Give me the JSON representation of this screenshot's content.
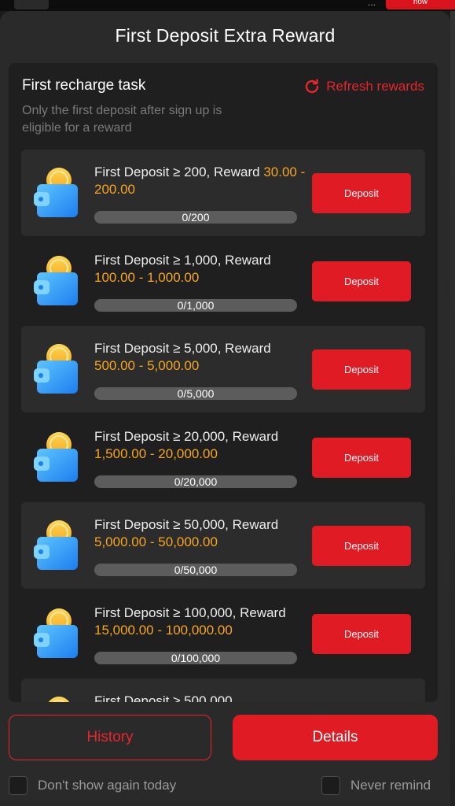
{
  "background": {
    "top_button_label": "now",
    "dots": "..."
  },
  "modal": {
    "title": "First Deposit Extra Reward"
  },
  "panel": {
    "heading": "First recharge task",
    "refresh_label": "Refresh rewards",
    "subtitle": "Only the first deposit after sign up is eligible for a reward"
  },
  "tasks": [
    {
      "title": "First Deposit ≥ 200, Reward ",
      "reward": "30.00 - 200.00",
      "progress_text": "0/200",
      "progress": 0,
      "button": "Deposit"
    },
    {
      "title": "First Deposit ≥ 1,000, Reward ",
      "reward": "100.00 - 1,000.00",
      "progress_text": "0/1,000",
      "progress": 0,
      "button": "Deposit"
    },
    {
      "title": "First Deposit ≥ 5,000, Reward ",
      "reward": "500.00 - 5,000.00",
      "progress_text": "0/5,000",
      "progress": 0,
      "button": "Deposit"
    },
    {
      "title": "First Deposit ≥ 20,000, Reward ",
      "reward": "1,500.00 - 20,000.00",
      "progress_text": "0/20,000",
      "progress": 0,
      "button": "Deposit"
    },
    {
      "title": "First Deposit ≥ 50,000, Reward ",
      "reward": "5,000.00 - 50,000.00",
      "progress_text": "0/50,000",
      "progress": 0,
      "button": "Deposit"
    },
    {
      "title": "First Deposit ≥ 100,000, Reward ",
      "reward": "15,000.00 - 100,000.00",
      "progress_text": "0/100,000",
      "progress": 0,
      "button": "Deposit"
    },
    {
      "title": "First Deposit ≥ 500,000",
      "reward": "",
      "progress_text": "",
      "progress": 0,
      "button": ""
    }
  ],
  "footer": {
    "history_label": "History",
    "details_label": "Details",
    "dont_show_label": "Don't show again today",
    "never_remind_label": "Never remind"
  },
  "colors": {
    "accent": "#e01b24",
    "reward": "#f5a623",
    "panel": "#1f1f1f",
    "modal": "#2a2a2a"
  },
  "icons": {
    "task_icon": "wallet-coin-icon",
    "refresh_icon": "refresh-icon"
  }
}
